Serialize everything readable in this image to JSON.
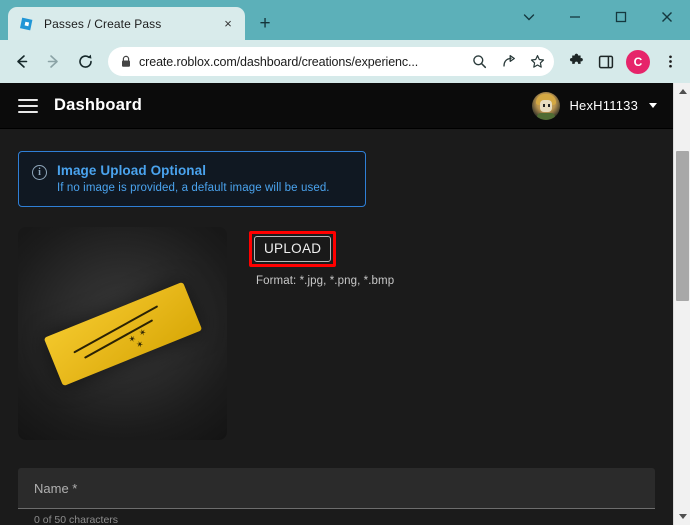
{
  "browser": {
    "tab": {
      "title": "Passes / Create Pass",
      "favicon_name": "roblox-favicon",
      "close_label": "×"
    },
    "new_tab_label": "+",
    "window_controls": {
      "tab_search": "⌄",
      "minimize": "−",
      "maximize": "□",
      "close": "✕"
    },
    "nav": {
      "back": "←",
      "forward": "→",
      "reload": "⟳"
    },
    "omnibox": {
      "url": "create.roblox.com/dashboard/creations/experienc...",
      "lock_icon": "lock-icon",
      "search_icon": "⌕",
      "share_icon": "⤳",
      "bookmark_icon": "☆"
    },
    "toolbar_icons": {
      "extensions": "❖",
      "side_panel": "▢",
      "profile_initial": "C",
      "menu": "⋮"
    }
  },
  "page": {
    "header": {
      "menu_label": "menu",
      "title": "Dashboard",
      "username": "HexH11133"
    },
    "notice": {
      "icon_letter": "i",
      "title": "Image Upload Optional",
      "subtitle": "If no image is provided, a default image will be used."
    },
    "upload": {
      "thumbnail_name": "default-pass-image",
      "button_label": "UPLOAD",
      "format_text": "Format: *.jpg, *.png, *.bmp",
      "highlight_color": "#ff0000"
    },
    "name_field": {
      "label": "Name *",
      "value": "",
      "hint": "0 of 50 characters"
    }
  },
  "colors": {
    "tabstrip": "#5cb0b9",
    "toolbar": "#d6eaea",
    "page_background": "#1b1b1b",
    "header_background": "#0b0b0b",
    "notice_border": "#2f7fd6",
    "notice_text": "#4aa3ee",
    "accent_gold": "#e8b91c"
  }
}
